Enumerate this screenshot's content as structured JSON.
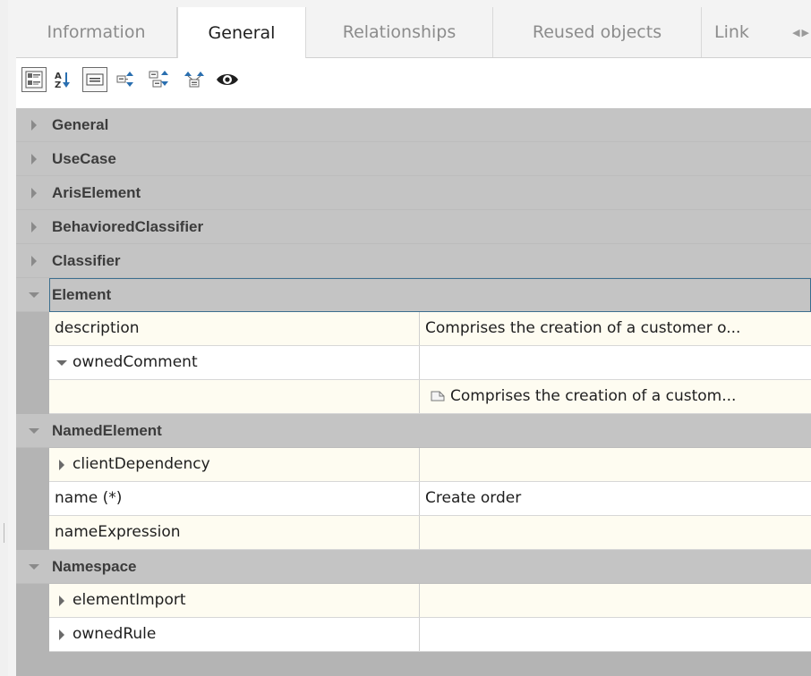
{
  "tabs": [
    {
      "label": "Information",
      "active": false
    },
    {
      "label": "General",
      "active": true
    },
    {
      "label": "Relationships",
      "active": false
    },
    {
      "label": "Reused objects",
      "active": false
    },
    {
      "label": "Link",
      "active": false
    }
  ],
  "toolbar": {
    "buttons": [
      "categorized-view",
      "sort-alphabetically",
      "show-description",
      "expand-all",
      "collapse-all",
      "filter",
      "show-hidden"
    ]
  },
  "categories": {
    "general": "General",
    "usecase": "UseCase",
    "ariselement": "ArisElement",
    "behavioredclassifier": "BehavioredClassifier",
    "classifier": "Classifier",
    "element": "Element",
    "namedelement": "NamedElement",
    "namespace": "Namespace"
  },
  "properties": {
    "description": {
      "name": "description",
      "value": "Comprises the creation of a customer o..."
    },
    "ownedcomment": {
      "name": "ownedComment",
      "value": ""
    },
    "comment": {
      "name": "",
      "value": "Comprises the creation of a custom..."
    },
    "clientdependency": {
      "name": "clientDependency",
      "value": ""
    },
    "name": {
      "name": "name (*)",
      "value": "Create order"
    },
    "nameexpression": {
      "name": "nameExpression",
      "value": ""
    },
    "elementimport": {
      "name": "elementImport",
      "value": ""
    },
    "ownedrule": {
      "name": "ownedRule",
      "value": ""
    }
  },
  "colors": {
    "category_bg": "#c4c4c4",
    "row_bg": "#ffffff",
    "row_alt_bg": "#fefcf1",
    "focus_border": "#3c6e8e"
  }
}
